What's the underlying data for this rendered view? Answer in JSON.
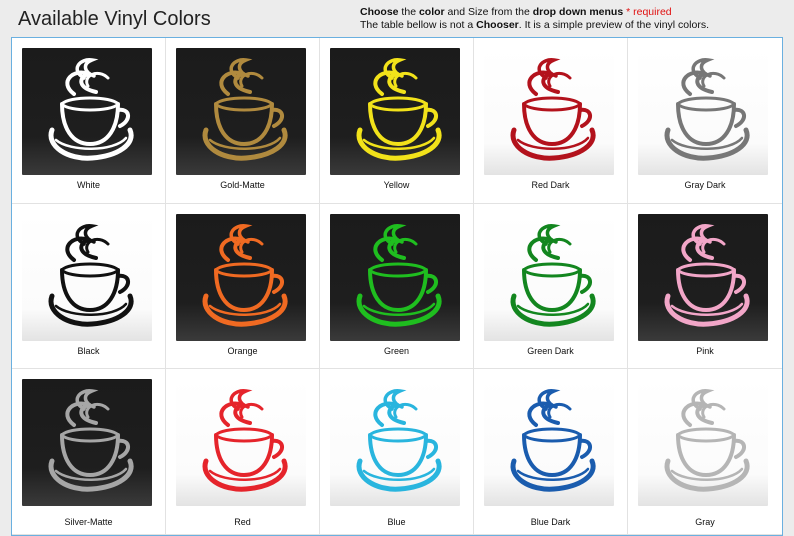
{
  "header": {
    "title": "Available Vinyl Colors",
    "line1": {
      "choose": "Choose",
      "the": " the ",
      "color": "color",
      "and": " and Size from the ",
      "menus": "drop down menus",
      "required": " * required"
    },
    "line2": {
      "pre": "The table bellow is not a ",
      "chooser": "Chooser",
      "post": ". It is a simple preview of the vinyl colors."
    }
  },
  "colors": [
    {
      "name": "White",
      "hex": "#ffffff",
      "bg": "dark"
    },
    {
      "name": "Gold-Matte",
      "hex": "#b08a3e",
      "bg": "dark"
    },
    {
      "name": "Yellow",
      "hex": "#f2e21a",
      "bg": "dark"
    },
    {
      "name": "Red Dark",
      "hex": "#b3121c",
      "bg": "light"
    },
    {
      "name": "Gray Dark",
      "hex": "#777777",
      "bg": "light"
    },
    {
      "name": "Black",
      "hex": "#111111",
      "bg": "light"
    },
    {
      "name": "Orange",
      "hex": "#f06a22",
      "bg": "dark"
    },
    {
      "name": "Green",
      "hex": "#1fbe1f",
      "bg": "dark"
    },
    {
      "name": "Green Dark",
      "hex": "#13861f",
      "bg": "light"
    },
    {
      "name": "Pink",
      "hex": "#f2a6c8",
      "bg": "dark"
    },
    {
      "name": "Silver-Matte",
      "hex": "#a6a6a6",
      "bg": "dark"
    },
    {
      "name": "Red",
      "hex": "#e5242b",
      "bg": "light"
    },
    {
      "name": "Blue",
      "hex": "#29b5de",
      "bg": "light"
    },
    {
      "name": "Blue Dark",
      "hex": "#1a5cae",
      "bg": "light"
    },
    {
      "name": "Gray",
      "hex": "#b5b5b5",
      "bg": "light"
    }
  ],
  "icon": "coffee-cup-icon"
}
